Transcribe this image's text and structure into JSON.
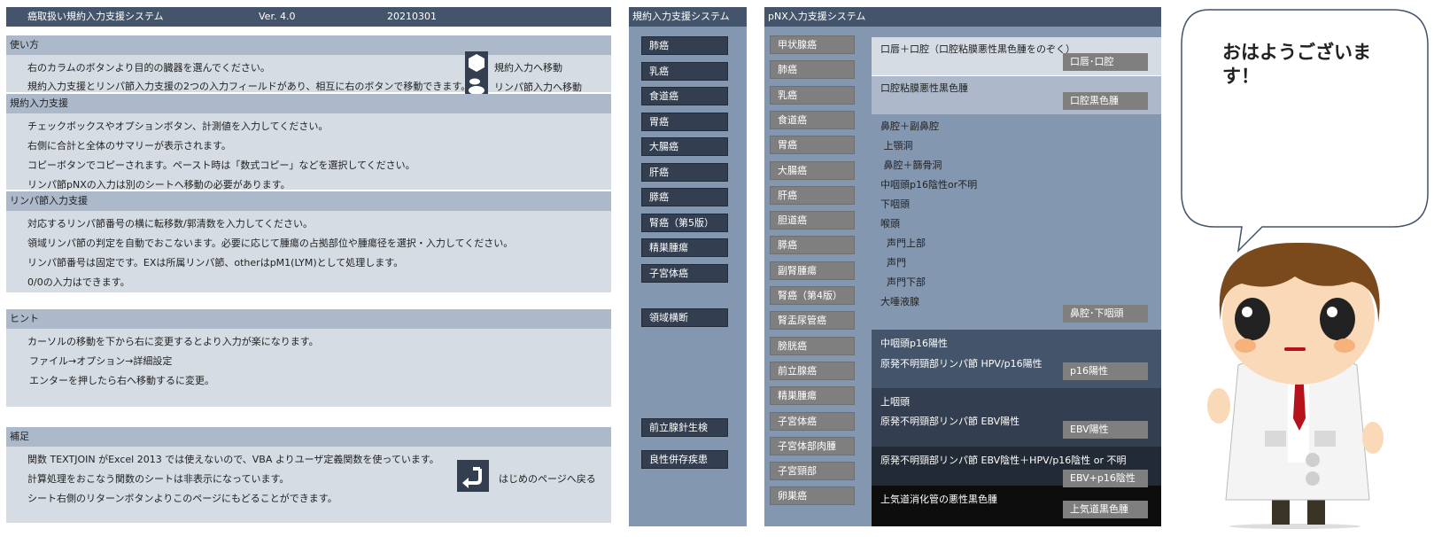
{
  "header": {
    "title": "癌取扱い規約入力支援システム",
    "version": "Ver. 4.0",
    "date": "20210301"
  },
  "howto": {
    "heading": "使い方",
    "lines": [
      "右のカラムのボタンより目的の臓器を選んでください。",
      "規約入力支援とリンパ節入力支援の2つの入力フィールドがあり、相互に右のボタンで移動できます。"
    ],
    "goto_rule": "規約入力へ移動",
    "goto_lymph": "リンパ節入力へ移動"
  },
  "rule_input": {
    "heading": "規約入力支援",
    "lines": [
      "チェックボックスやオプションボタン、計測値を入力してください。",
      "右側に合計と全体のサマリーが表示されます。",
      "コピーボタンでコピーされます。ペースト時は「数式コピー」などを選択してください。",
      "リンパ節pNXの入力は別のシートへ移動の必要があります。"
    ]
  },
  "lymph_input": {
    "heading": "リンパ節入力支援",
    "lines": [
      "対応するリンパ節番号の横に転移数/郭清数を入力してください。",
      "領域リンパ節の判定を自動でおこないます。必要に応じて腫瘍の占拠部位や腫瘍径を選択・入力してください。",
      "リンパ節番号は固定です。EXは所属リンパ節、otherはpM1(LYM)として処理します。",
      "0/0の入力はできます。"
    ]
  },
  "hint": {
    "heading": "ヒント",
    "lines": [
      "カーソルの移動を下から右に変更するとより入力が楽になります。",
      "ファイル→オプション→詳細設定",
      "エンターを押したら右へ移動するに変更。"
    ]
  },
  "supplement": {
    "heading": "補足",
    "lines": [
      "関数 TEXTJOIN がExcel 2013 では使えないので、VBA よりユーザ定義関数を使っています。",
      "計算処理をおこなう関数のシートは非表示になっています。",
      "シート右側のリターンボタンよりこのページにもどることができます。"
    ],
    "return_label": "はじめのページへ戻る"
  },
  "rule_column": {
    "title": "規約入力支援システム",
    "buttons": [
      "肺癌",
      "乳癌",
      "食道癌",
      "胃癌",
      "大腸癌",
      "肝癌",
      "膵癌",
      "腎癌（第5版）",
      "精巣腫瘍",
      "子宮体癌"
    ],
    "extra1": "領域横断",
    "extra2": "前立腺針生検",
    "extra3": "良性併存疾患"
  },
  "pnx_column": {
    "title": "pNX入力支援システム",
    "buttons": [
      "甲状腺癌",
      "肺癌",
      "乳癌",
      "食道癌",
      "胃癌",
      "大腸癌",
      "肝癌",
      "胆道癌",
      "膵癌",
      "副腎腫瘍",
      "腎癌（第4版）",
      "腎盂尿管癌",
      "膀胱癌",
      "前立腺癌",
      "精巣腫瘍",
      "子宮体癌",
      "子宮体部肉腫",
      "子宮頸部",
      "卵巣癌"
    ]
  },
  "head_neck": {
    "oral_title": "口唇＋口腔（口腔粘膜悪性黒色腫をのぞく）",
    "oral_btn": "口唇･口腔",
    "mucosal_title": "口腔粘膜悪性黒色腫",
    "mucosal_btn": "口腔黒色腫",
    "nasal_lines": [
      "鼻腔＋副鼻腔",
      " 上顎洞",
      " 鼻腔＋篩骨洞",
      "中咽頭p16陰性or不明",
      "下咽頭",
      "喉頭",
      "  声門上部",
      "  声門",
      "  声門下部",
      "大唾液腺"
    ],
    "nasal_btn": "鼻腔･下咽頭",
    "p16_lines": [
      "中咽頭p16陽性",
      "原発不明頸部リンパ節  HPV/p16陽性"
    ],
    "p16_btn": "p16陽性",
    "ebv_lines": [
      "上咽頭",
      "原発不明頸部リンパ節  EBV陽性"
    ],
    "ebv_btn": "EBV陽性",
    "ebvneg_line": "原発不明頸部リンパ節  EBV陰性＋HPV/p16陰性 or 不明",
    "ebvneg_btn": "EBV+p16陰性",
    "melanoma_line": "上気道消化管の悪性黒色腫",
    "melanoma_btn": "上気道黒色腫"
  },
  "speech": {
    "text": "おはようございます！"
  }
}
